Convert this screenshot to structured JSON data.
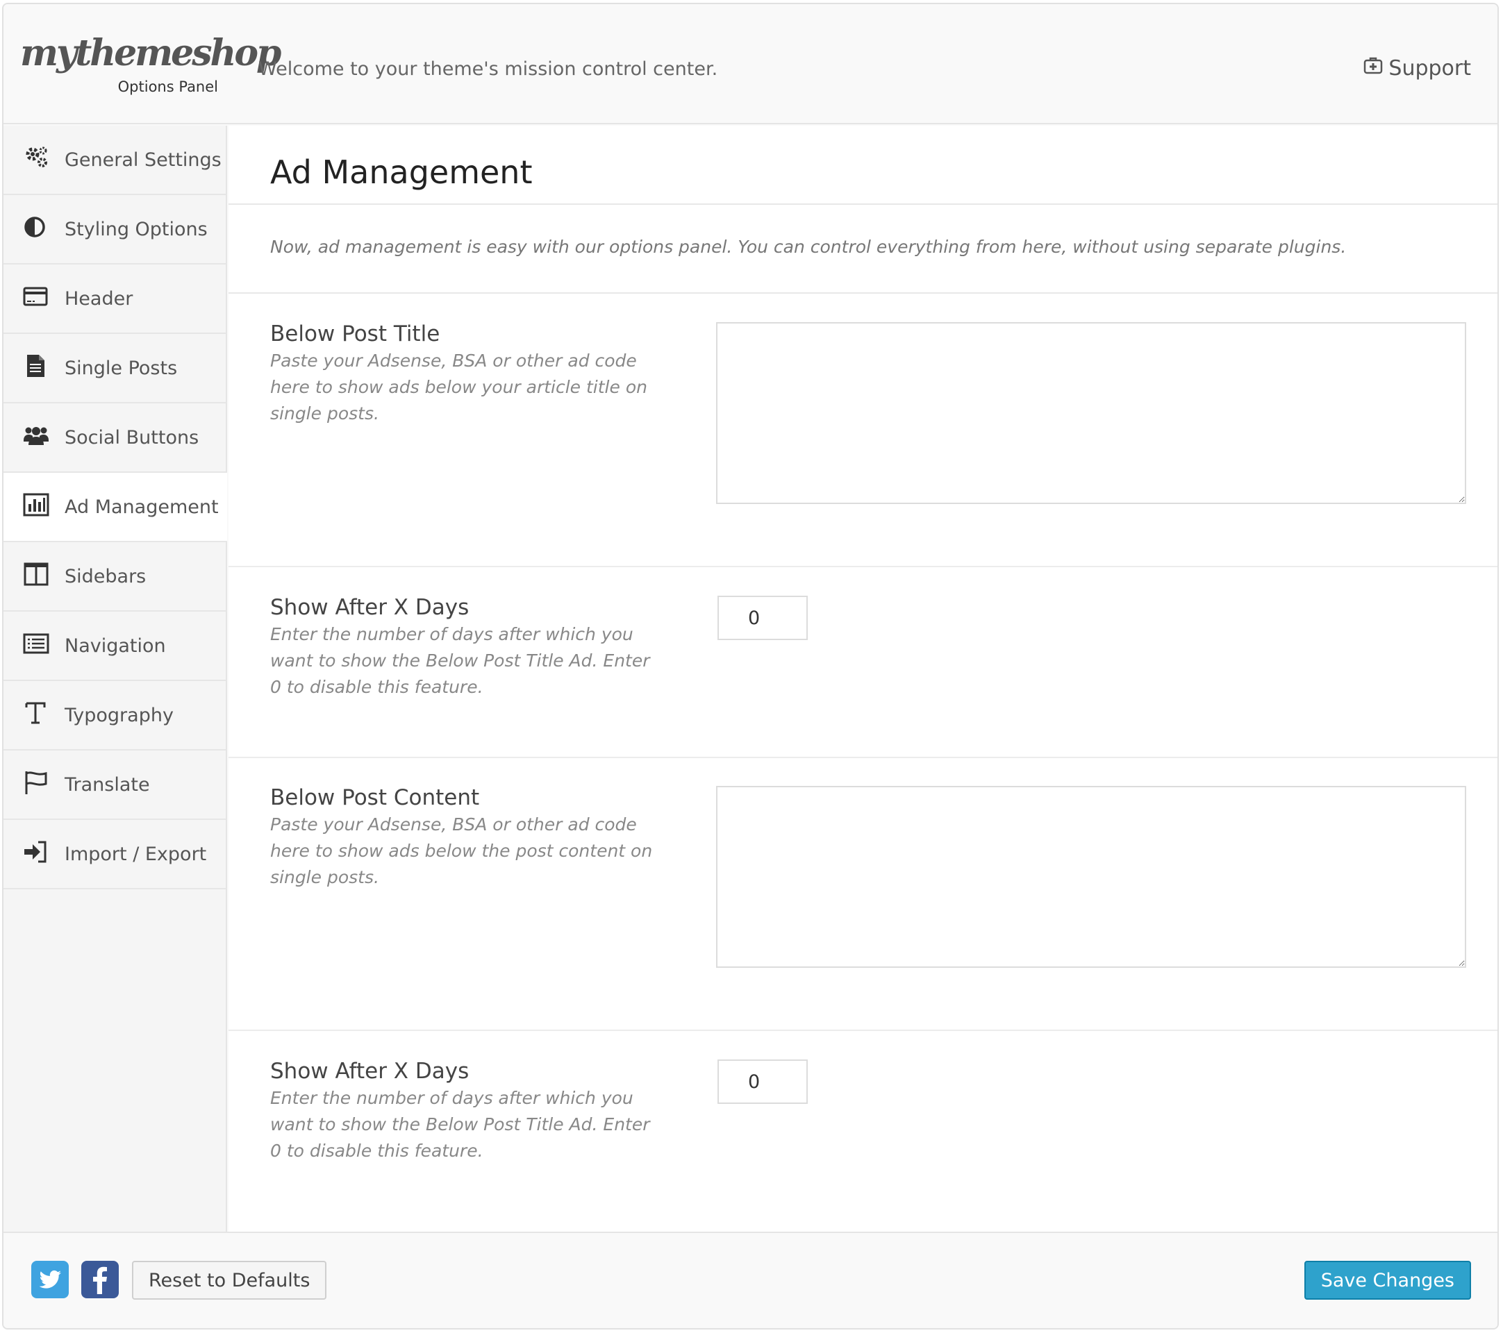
{
  "header": {
    "logo_word": "mythemeshop",
    "logo_sub": "Options Panel",
    "welcome": "Welcome to your theme's mission control center.",
    "support_label": "Support",
    "support_icon": "medkit-icon"
  },
  "sidebar": {
    "items": [
      {
        "label": "General Settings",
        "icon": "gears-icon"
      },
      {
        "label": "Styling Options",
        "icon": "contrast-icon"
      },
      {
        "label": "Header",
        "icon": "header-card-icon"
      },
      {
        "label": "Single Posts",
        "icon": "document-icon"
      },
      {
        "label": "Social Buttons",
        "icon": "users-icon"
      },
      {
        "label": "Ad Management",
        "icon": "bar-chart-icon"
      },
      {
        "label": "Sidebars",
        "icon": "columns-icon"
      },
      {
        "label": "Navigation",
        "icon": "list-icon"
      },
      {
        "label": "Typography",
        "icon": "text-icon"
      },
      {
        "label": "Translate",
        "icon": "flag-icon"
      },
      {
        "label": "Import / Export",
        "icon": "sign-in-icon"
      }
    ],
    "active_index": 5
  },
  "main": {
    "title": "Ad Management",
    "intro": "Now, ad management is easy with our options panel. You can control everything from here, without using separate plugins.",
    "options": [
      {
        "label": "Below Post Title",
        "description": "Paste your Adsense, BSA or other ad code here to show ads below your article title on single posts.",
        "value": ""
      },
      {
        "label": "Show After X Days",
        "description": "Enter the number of days after which you want to show the Below Post Title Ad. Enter 0 to disable this feature.",
        "value": "0"
      },
      {
        "label": "Below Post Content",
        "description": "Paste your Adsense, BSA or other ad code here to show ads below the post content on single posts.",
        "value": ""
      },
      {
        "label": "Show After X Days",
        "description": "Enter the number of days after which you want to show the Below Post Title Ad. Enter 0 to disable this feature.",
        "value": "0"
      }
    ]
  },
  "footer": {
    "reset_label": "Reset to Defaults",
    "save_label": "Save Changes",
    "twitter_icon": "twitter-icon",
    "facebook_icon": "facebook-icon"
  },
  "colors": {
    "save_button": "#2ea2cc",
    "twitter": "#3fa3e0",
    "facebook": "#3b5998"
  }
}
